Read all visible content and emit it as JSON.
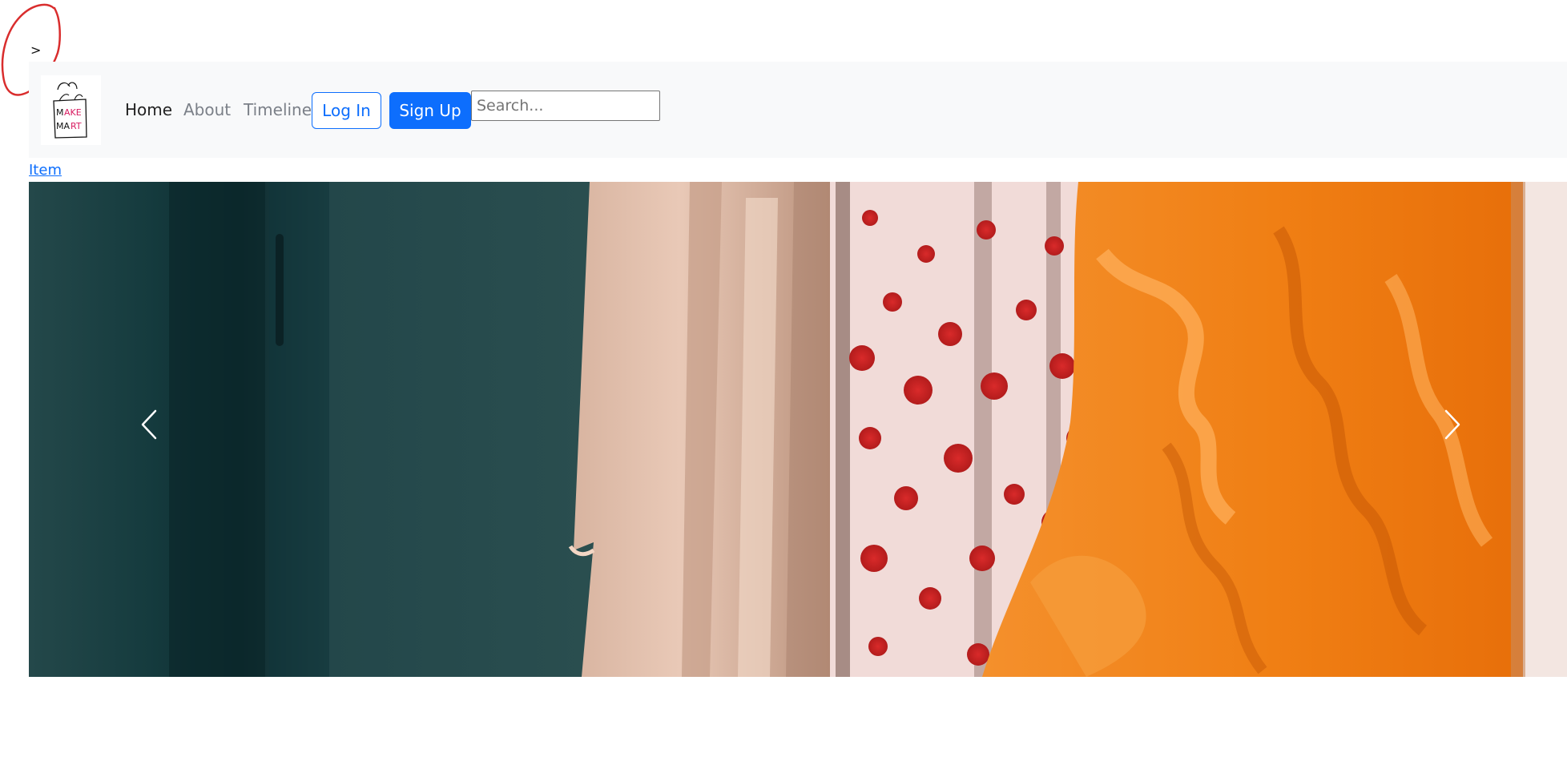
{
  "top_toggle": {
    "glyph": ">"
  },
  "brand": {
    "logo_text_top": "MAKE",
    "logo_text_bottom": "MART"
  },
  "nav": {
    "links": [
      {
        "label": "Home",
        "active": true
      },
      {
        "label": "About",
        "active": false
      },
      {
        "label": "Timeline",
        "active": false
      }
    ],
    "login_label": "Log In",
    "signup_label": "Sign Up",
    "search": {
      "placeholder": "Search...",
      "value": ""
    }
  },
  "content": {
    "item_link_label": "Item"
  },
  "colors": {
    "accent": "#0d6efd",
    "navbar_background": "#f8f9fa",
    "annotation_red": "#d92d2d"
  },
  "icons": {
    "prev": "chevron-left-icon",
    "next": "chevron-right-icon"
  }
}
